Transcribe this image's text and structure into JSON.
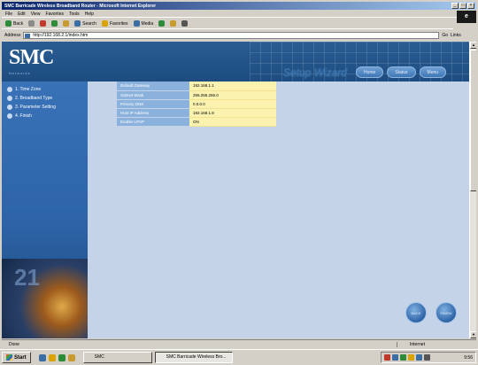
{
  "window": {
    "title": "SMC Barricade Wireless Broadband Router - Microsoft Internet Explorer",
    "controls": [
      "_",
      "□",
      "×"
    ]
  },
  "menubar": [
    "File",
    "Edit",
    "View",
    "Favorites",
    "Tools",
    "Help"
  ],
  "toolbar": {
    "items": [
      {
        "label": "Back",
        "icon": "back-arrow-icon",
        "color": "#2e8b3a"
      },
      {
        "label": "",
        "icon": "forward-arrow-icon",
        "color": "#8a8a8a"
      },
      {
        "label": "",
        "icon": "stop-icon",
        "color": "#c0392b"
      },
      {
        "label": "",
        "icon": "refresh-icon",
        "color": "#2e8b3a"
      },
      {
        "label": "",
        "icon": "home-icon",
        "color": "#c99a2e"
      },
      {
        "label": "Search",
        "icon": "search-icon",
        "color": "#3a6ea5"
      },
      {
        "label": "Favorites",
        "icon": "favorites-icon",
        "color": "#d9a400"
      },
      {
        "label": "Media",
        "icon": "media-icon",
        "color": "#3a6ea5"
      },
      {
        "label": "",
        "icon": "history-icon",
        "color": "#2e8b3a"
      },
      {
        "label": "",
        "icon": "mail-icon",
        "color": "#c99a2e"
      },
      {
        "label": "",
        "icon": "print-icon",
        "color": "#555555"
      }
    ]
  },
  "address": {
    "label": "Address",
    "url": "http://192.168.2.1/index.htm",
    "go": "Go",
    "links": "Links"
  },
  "brand": {
    "logo": "SMC",
    "tagline": "Networks",
    "wizard_title": "Setup Wizard",
    "tabs": [
      "Home",
      "Status",
      "Menu"
    ]
  },
  "sidebar": {
    "items": [
      {
        "label": "1. Time Zone"
      },
      {
        "label": "2. Broadband Type"
      },
      {
        "label": "3. Parameter Setting"
      },
      {
        "label": "4. Finish"
      }
    ],
    "art_number": "21"
  },
  "info_table": {
    "rows": [
      {
        "key": "Default Gateway",
        "value": "192.168.1.1"
      },
      {
        "key": "Subnet Mask",
        "value": "255.255.255.0"
      },
      {
        "key": "Primary DNS",
        "value": "0.0.0.0"
      },
      {
        "key": "Host IP Address",
        "value": "192.168.1.8"
      },
      {
        "key": "Enable UPnP",
        "value": "ON"
      }
    ]
  },
  "buttons": {
    "back": "BACK",
    "finish": "FINISH"
  },
  "statusbar": {
    "text": "Done",
    "zone": "Internet"
  },
  "taskbar": {
    "start": "Start",
    "quick_launch": [
      {
        "icon": "ie-icon",
        "color": "#3a6ea5"
      },
      {
        "icon": "outlook-icon",
        "color": "#d9a400"
      },
      {
        "icon": "desktop-icon",
        "color": "#2e8b3a"
      },
      {
        "icon": "folder-icon",
        "color": "#c99a2e"
      }
    ],
    "tasks": [
      {
        "label": "SMC",
        "active": false
      },
      {
        "label": "SMC Barricade Wireless Bro...",
        "active": true
      }
    ],
    "tray_icons": [
      "#c0392b",
      "#3a6ea5",
      "#2e8b3a",
      "#d9a400",
      "#3a6ea5",
      "#555555"
    ],
    "clock": "9:56"
  }
}
